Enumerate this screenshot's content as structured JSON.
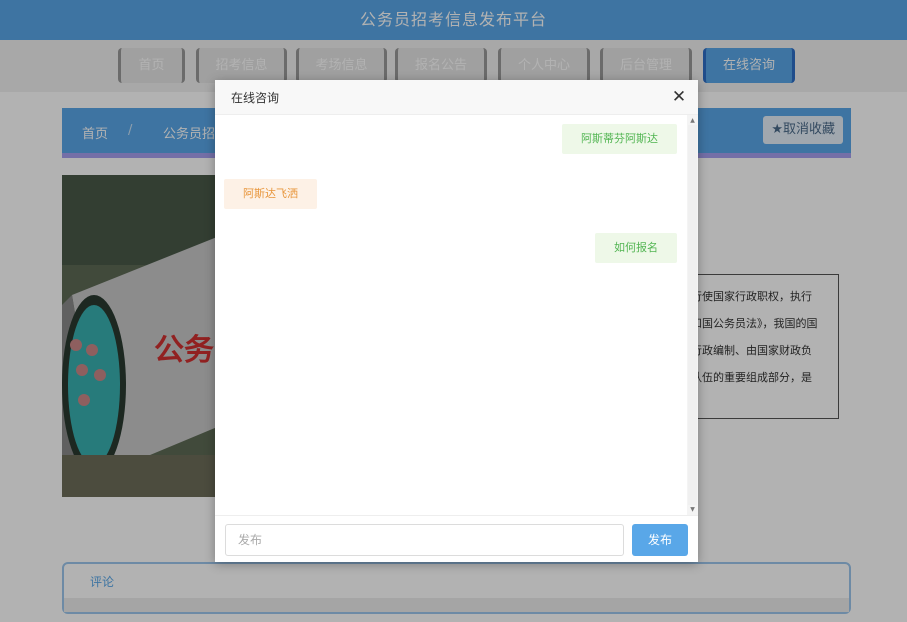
{
  "header": {
    "title": "公务员招考信息发布平台"
  },
  "nav": {
    "items": [
      {
        "label": "首页"
      },
      {
        "label": "招考信息"
      },
      {
        "label": "考场信息"
      },
      {
        "label": "报名公告"
      },
      {
        "label": "个人中心"
      },
      {
        "label": "后台管理"
      },
      {
        "label": "在线咨询"
      }
    ]
  },
  "breadcrumb": {
    "home": "首页",
    "separator": "/",
    "current": "公务员招"
  },
  "favorite": {
    "label": "取消收藏"
  },
  "image_caption": "公务",
  "article": {
    "lines": [
      "行使国家行政职权，执行",
      "和国公务员法》，我国的国",
      "行政编制、由国家财政负",
      "队伍的重要组成部分，是"
    ]
  },
  "comment": {
    "label": "评论"
  },
  "chat": {
    "title": "在线咨询",
    "messages": [
      {
        "side": "mine",
        "text": "阿斯蒂芬阿斯达"
      },
      {
        "side": "theirs",
        "text": "阿斯达飞洒"
      },
      {
        "side": "mine",
        "text": "如何报名"
      }
    ],
    "input_placeholder": "发布",
    "send_label": "发布"
  },
  "colors": {
    "accent": "#59a7e8",
    "mine_bubble_text": "#52b552",
    "theirs_bubble_text": "#e8963c"
  }
}
